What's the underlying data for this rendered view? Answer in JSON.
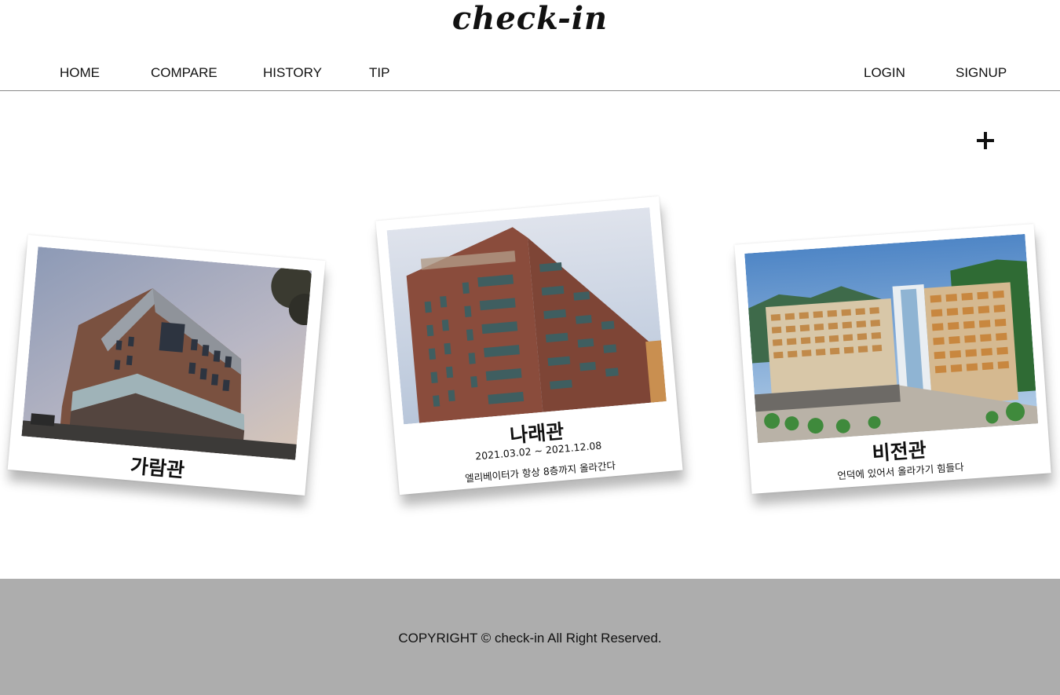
{
  "header": {
    "logo": "check-in",
    "nav_left": [
      "HOME",
      "COMPARE",
      "HISTORY",
      "TIP"
    ],
    "nav_right": [
      "LOGIN",
      "SIGNUP"
    ]
  },
  "add_button": {
    "icon": "plus-icon"
  },
  "cards": [
    {
      "title": "가람관",
      "date": "",
      "memo": "",
      "photo_desc": "brown-brick-building-photo"
    },
    {
      "title": "나래관",
      "date": "2021.03.02 ~ 2021.12.08",
      "memo": "엘리베이터가 항상 8층까지 올라간다",
      "photo_desc": "red-brick-tower-photo"
    },
    {
      "title": "비전관",
      "date": "",
      "memo": "언덕에 있어서 올라가기 힘들다",
      "photo_desc": "campus-complex-photo"
    }
  ],
  "footer": {
    "copyright": "COPYRIGHT © check-in All Right Reserved."
  },
  "colors": {
    "footer_bg": "#adadad",
    "text": "#111111",
    "divider": "#8a8a8a"
  }
}
